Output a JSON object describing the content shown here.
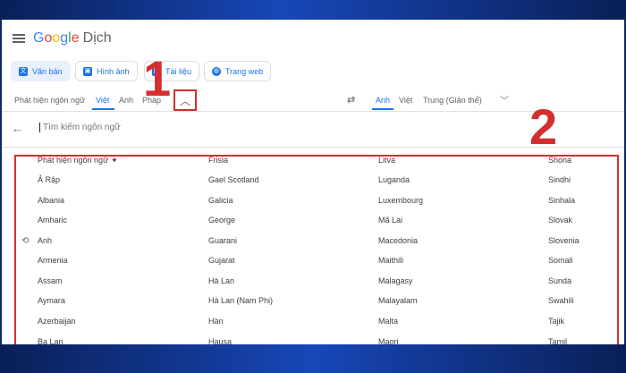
{
  "app": {
    "logo_parts": [
      "G",
      "o",
      "o",
      "g",
      "l",
      "e"
    ],
    "product": "Dịch"
  },
  "modes": [
    {
      "label": "Văn bản",
      "icon": "translate-icon",
      "active": true
    },
    {
      "label": "Hình ảnh",
      "icon": "image-icon",
      "active": false
    },
    {
      "label": "Tài liệu",
      "icon": "document-icon",
      "active": false
    },
    {
      "label": "Trang web",
      "icon": "globe-icon",
      "active": false
    }
  ],
  "source_langs": [
    "Phát hiện ngôn ngữ",
    "Việt",
    "Anh",
    "Pháp"
  ],
  "source_selected": "Việt",
  "target_langs": [
    "Anh",
    "Việt",
    "Trung (Giản thể)"
  ],
  "target_selected": "Anh",
  "search": {
    "placeholder": "Tìm kiếm ngôn ngữ"
  },
  "annotations": {
    "step1": "1",
    "step2": "2"
  },
  "languages": {
    "col1": [
      "Phát hiện ngôn ngữ",
      "Ả Rập",
      "Albania",
      "Amharic",
      "Anh",
      "Armenia",
      "Assam",
      "Aymara",
      "Azerbaijan",
      "Ba Lan"
    ],
    "col2": [
      "Frisia",
      "Gael Scotland",
      "Galicia",
      "George",
      "Guarani",
      "Gujarat",
      "Hà Lan",
      "Hà Lan (Nam Phi)",
      "Hàn",
      "Hausa"
    ],
    "col3": [
      "Litva",
      "Luganda",
      "Luxembourg",
      "Mã Lai",
      "Macedonia",
      "Maithili",
      "Malagasy",
      "Malayalam",
      "Malta",
      "Maori"
    ],
    "col4": [
      "Shona",
      "Sindhi",
      "Sinhala",
      "Slovak",
      "Slovenia",
      "Somali",
      "Sunda",
      "Swahili",
      "Tajik",
      "Tamil"
    ]
  },
  "colors": {
    "accent": "#1a73e8",
    "highlight": "#d32f2f"
  }
}
